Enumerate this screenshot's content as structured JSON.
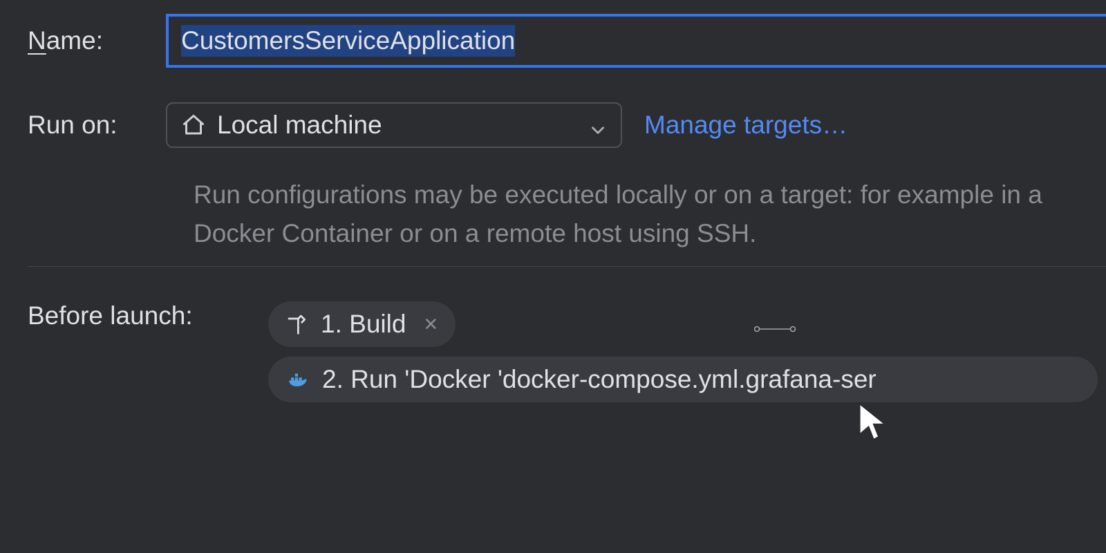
{
  "name": {
    "label_prefix": "N",
    "label_suffix": "ame:",
    "value": "CustomersServiceApplication"
  },
  "run_on": {
    "label": "Run on:",
    "selected": "Local machine",
    "manage_link": "Manage targets…",
    "help": "Run configurations may be executed locally or on a target: for example in a Docker Container or on a remote host using SSH."
  },
  "before_launch": {
    "label": "Before launch:",
    "items": [
      {
        "icon": "hammer",
        "text": "1. Build",
        "closable": true
      },
      {
        "icon": "docker",
        "text": "2. Run 'Docker 'docker-compose.yml.grafana-ser",
        "closable": false
      }
    ]
  }
}
